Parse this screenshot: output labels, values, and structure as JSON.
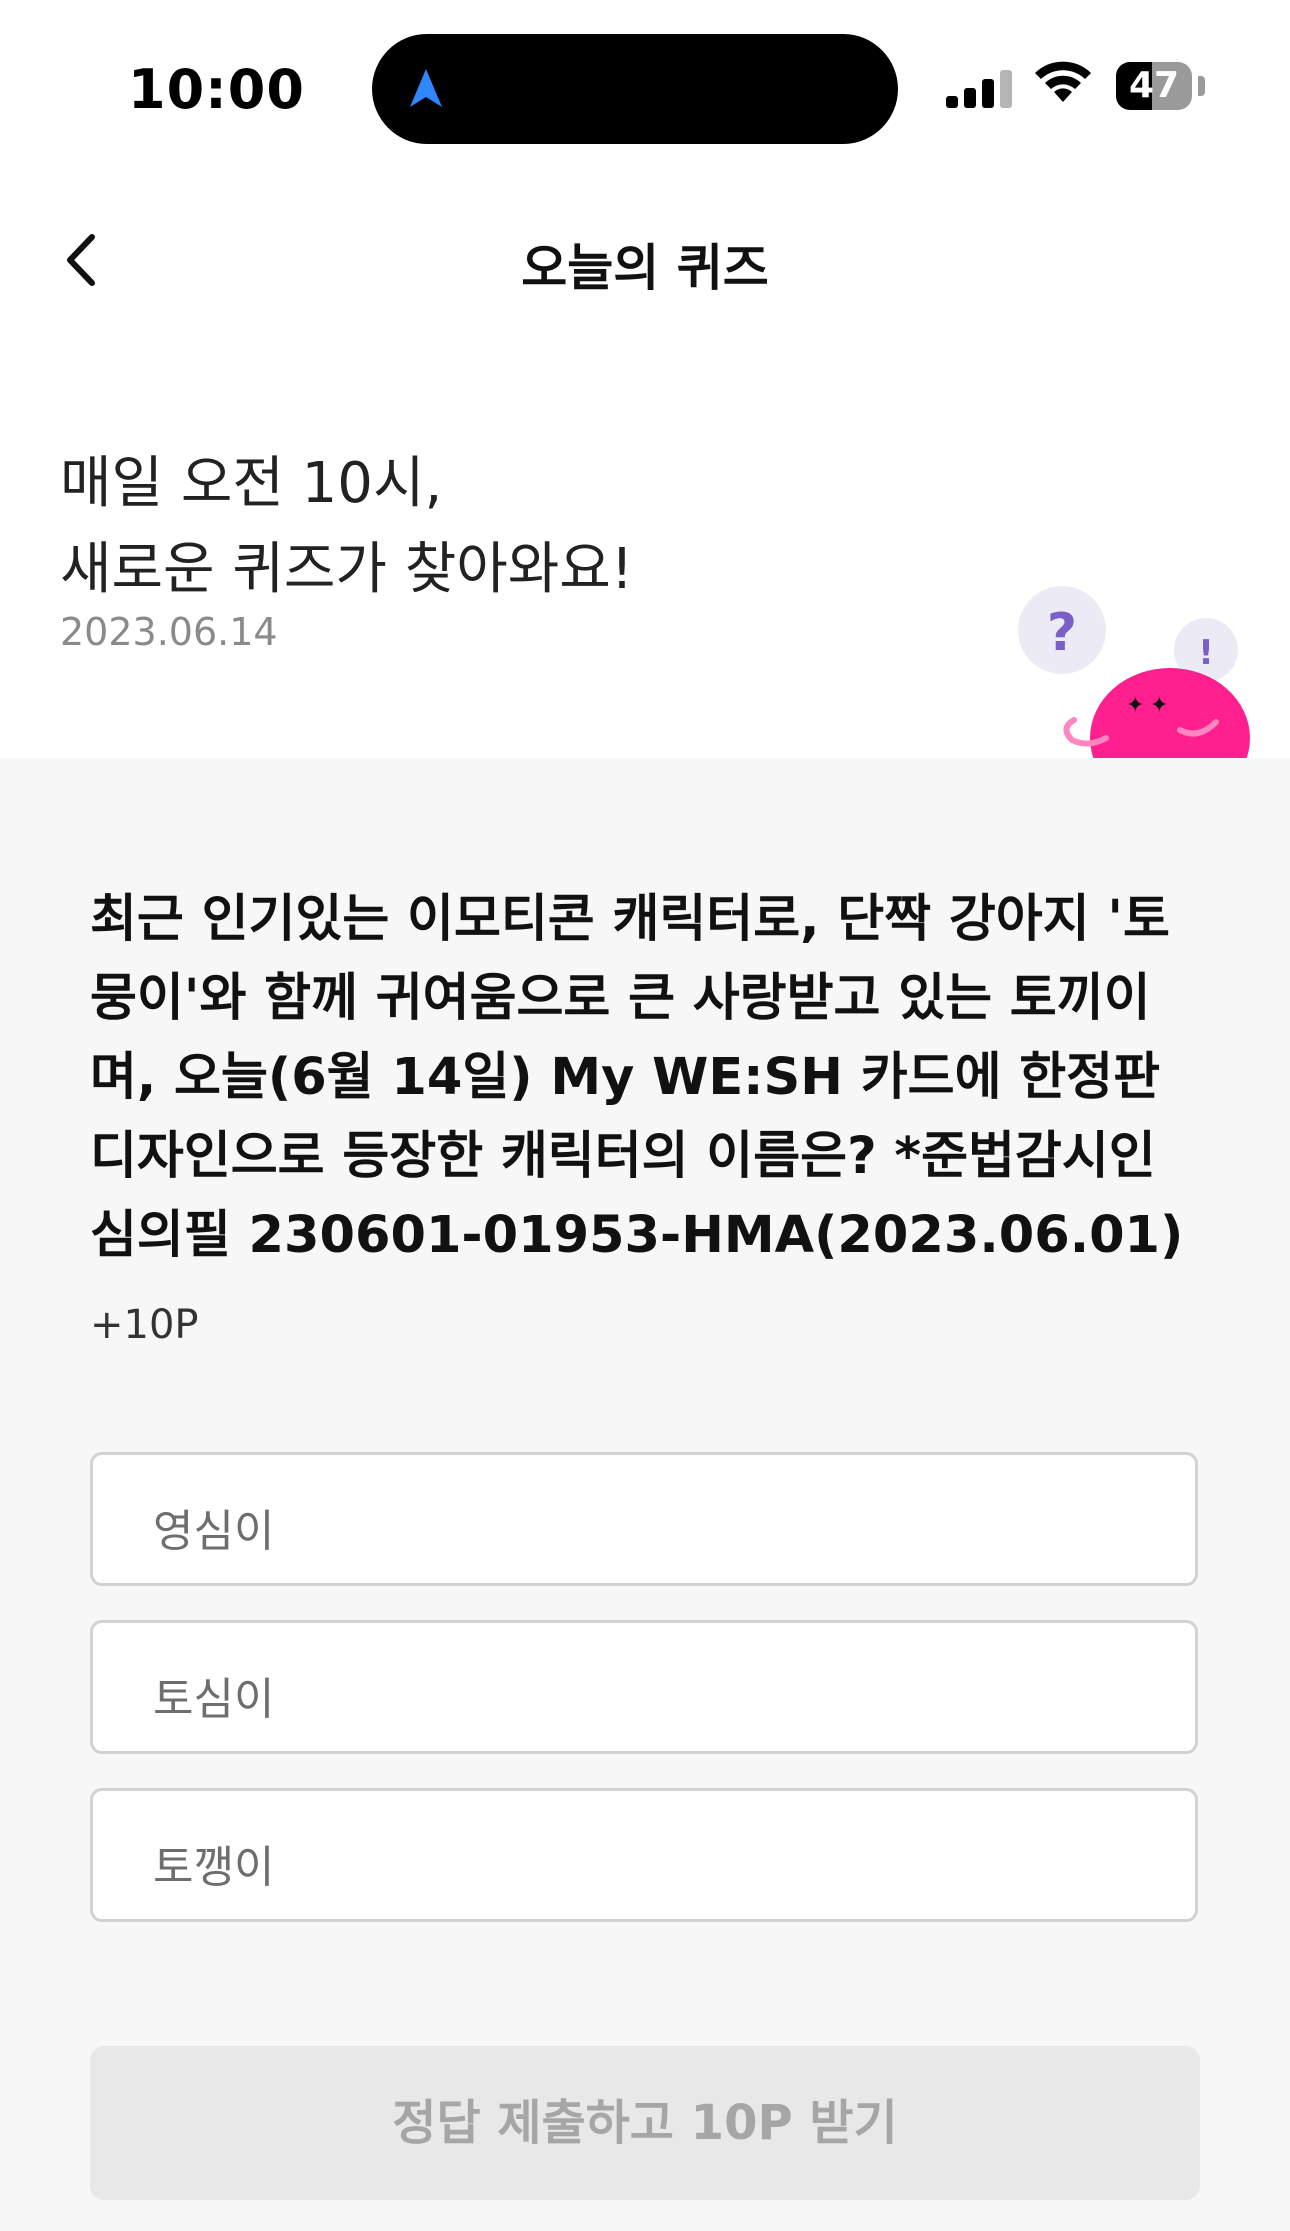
{
  "status_bar": {
    "time": "10:00",
    "battery_level": "47",
    "battery_fraction": 0.47,
    "icons": [
      "location-arrow-icon",
      "signal-icon",
      "wifi-icon",
      "battery-icon"
    ]
  },
  "header": {
    "back_icon": "chevron-left-icon",
    "title": "오늘의 퀴즈"
  },
  "intro": {
    "line1": "매일 오전 10시,",
    "line2": "새로운 퀴즈가 찾아와요!",
    "date": "2023.06.14"
  },
  "quiz": {
    "question": "최근 인기있는 이모티콘 캐릭터로, 단짝 강아지 '토뭉이'와 함께 귀여움으로 큰 사랑받고 있는 토끼이며, 오늘(6월 14일) My WE:SH 카드에 한정판 디자인으로 등장한 캐릭터의 이름은? *준법감시인심의필 230601-01953-HMA(2023.06.01)",
    "points": "+10P",
    "options": [
      "영심이",
      "토심이",
      "토깽이"
    ],
    "submit_label": "정답 제출하고 10P 받기"
  },
  "colors": {
    "accent": "#ff1f8e",
    "mascot_bubble": "#ecebf5",
    "question_mark": "#7b5fc9",
    "background": "#f7f7f7"
  }
}
